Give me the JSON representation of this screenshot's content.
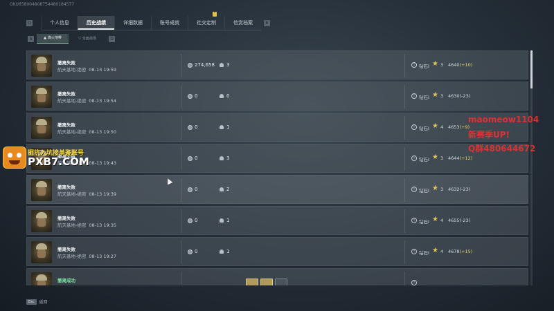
{
  "uid": "OKU658004808754480184577",
  "topnav": {
    "left_key": "Q",
    "right_key": "E",
    "tabs": [
      {
        "label": "个人信息"
      },
      {
        "label": "历史战绩",
        "active": true
      },
      {
        "label": "详细数据"
      },
      {
        "label": "账号成就"
      },
      {
        "label": "社交定制",
        "notice": "!"
      },
      {
        "label": "信赏档案"
      }
    ]
  },
  "subtabs": {
    "left_key": "A",
    "right_key": "D",
    "items": [
      {
        "label": "烽火地带",
        "active": true
      },
      {
        "label": "全面战场"
      }
    ]
  },
  "icons": {
    "coin": "coin-icon",
    "kills": "skull-icon",
    "rank": "rank-icon",
    "star": "star-icon"
  },
  "colors": {
    "win": "#7fe3a2",
    "score_gain": "#e7d56a",
    "star": "#e1c35a",
    "watermark": "#ff2d2d"
  },
  "matches": [
    {
      "result": "撤离失败",
      "map": "航天基地-绝密",
      "time": "08-13 19:59",
      "money": "274,658",
      "kills": "3",
      "rank": "钻石I",
      "stars": "3",
      "score": "4640",
      "delta": "(+10)"
    },
    {
      "result": "撤离失败",
      "map": "航天基地-绝密",
      "time": "08-13 19:54",
      "money": "0",
      "kills": "0",
      "rank": "钻石I",
      "stars": "3",
      "score": "4630",
      "delta": "(-23)"
    },
    {
      "result": "撤离失败",
      "map": "航天基地-绝密",
      "time": "08-13 19:50",
      "money": "0",
      "kills": "1",
      "rank": "钻石I",
      "stars": "4",
      "score": "4653",
      "delta": "(+9)"
    },
    {
      "result": "撤离失败",
      "map": "航天基地-绝密",
      "time": "08-13 19:43",
      "money": "0",
      "kills": "3",
      "rank": "钻石I",
      "stars": "3",
      "score": "4644",
      "delta": "(+12)"
    },
    {
      "result": "撤离失败",
      "map": "航天基地-绝密",
      "time": "08-13 19:39",
      "money": "0",
      "kills": "2",
      "rank": "钻石I",
      "stars": "3",
      "score": "4632",
      "delta": "(-23)"
    },
    {
      "result": "撤离失败",
      "map": "航天基地-绝密",
      "time": "08-13 19:35",
      "money": "0",
      "kills": "1",
      "rank": "钻石I",
      "stars": "4",
      "score": "4655",
      "delta": "(-23)"
    },
    {
      "result": "撤离失败",
      "map": "航天基地-绝密",
      "time": "08-13 19:27",
      "money": "0",
      "kills": "1",
      "rank": "钻石I",
      "stars": "4",
      "score": "4678",
      "delta": "(+15)"
    },
    {
      "result": "撤离成功",
      "map": "",
      "time": "",
      "money": "",
      "kills": "",
      "rank": "",
      "stars": "",
      "score": "",
      "delta": "",
      "win": true
    }
  ],
  "footer": {
    "key": "Esc",
    "label": "返回"
  },
  "watermark": {
    "lines": [
      "maomeow1104",
      "新赛季UP!",
      "Q群480644672"
    ]
  },
  "logo": {
    "line1": "掘抗入坑接单鉴账号",
    "line2": "PXB7.COM"
  }
}
